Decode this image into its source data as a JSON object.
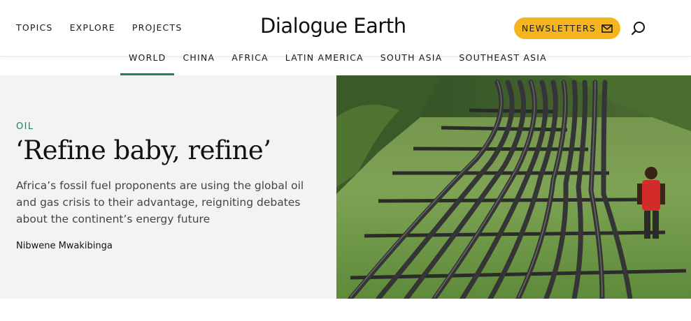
{
  "header": {
    "nav": [
      "TOPICS",
      "EXPLORE",
      "PROJECTS"
    ],
    "logo": "Dialogue Earth",
    "newsletter_label": "NEWSLETTERS",
    "newsletter_color": "#f5b51f"
  },
  "subnav": {
    "tabs": [
      "WORLD",
      "CHINA",
      "AFRICA",
      "LATIN AMERICA",
      "SOUTH ASIA",
      "SOUTHEAST ASIA"
    ],
    "active": "WORLD",
    "accent": "#1e7c73"
  },
  "feature": {
    "kicker": "OIL",
    "headline": "‘Refine baby, refine’",
    "dek": "Africa’s fossil fuel proponents are using the global oil and gas crisis to their advantage, reigniting debates about the continent’s energy future",
    "byline": "Nibwene Mwakibinga"
  }
}
